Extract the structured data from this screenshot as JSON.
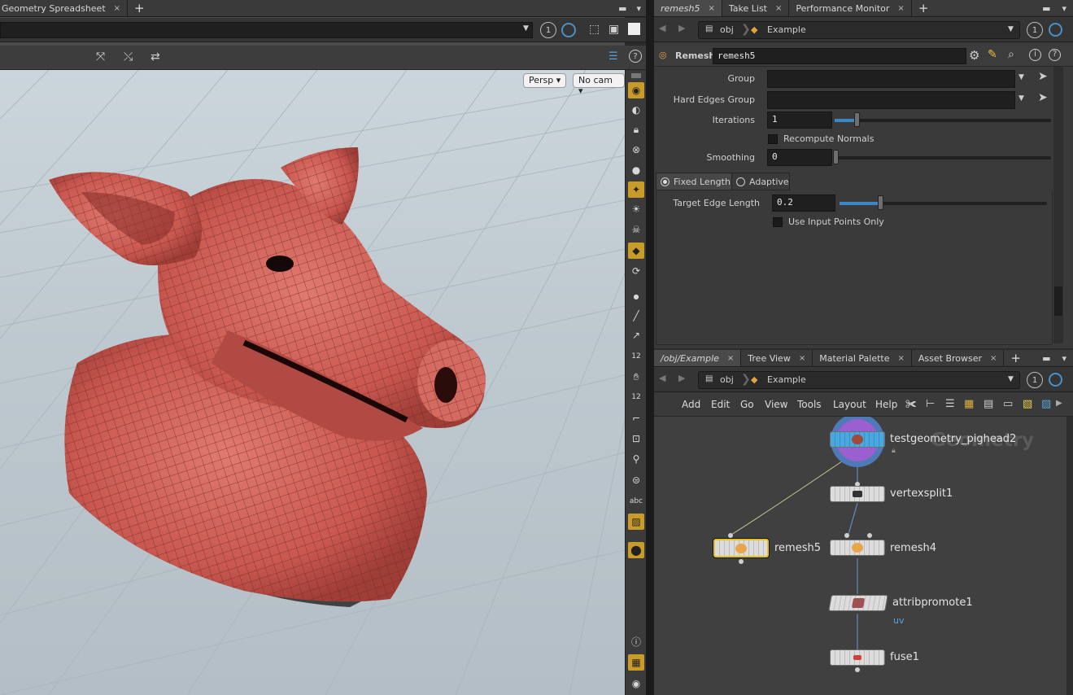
{
  "left": {
    "tab": "Geometry Spreadsheet",
    "camera": {
      "persp": "Persp",
      "cam": "No cam"
    },
    "path_num": "1"
  },
  "param_pane": {
    "tabs": [
      {
        "label": "remesh5",
        "active": true
      },
      {
        "label": "Take List"
      },
      {
        "label": "Performance Monitor"
      }
    ],
    "path": {
      "obj": "obj",
      "net": "Example",
      "num": "1"
    },
    "node_type": "Remesh",
    "node_name": "remesh5",
    "params": {
      "group_label": "Group",
      "hard_edges_label": "Hard Edges Group",
      "iterations_label": "Iterations",
      "iterations_value": "1",
      "recompute_label": "Recompute Normals",
      "smoothing_label": "Smoothing",
      "smoothing_value": "0",
      "mode_fixed": "Fixed Length",
      "mode_adaptive": "Adaptive",
      "target_label": "Target Edge Length",
      "target_value": "0.2",
      "input_points_label": "Use Input Points Only"
    }
  },
  "network_pane": {
    "tabs": [
      {
        "label": "/obj/Example",
        "active": true
      },
      {
        "label": "Tree View"
      },
      {
        "label": "Material Palette"
      },
      {
        "label": "Asset Browser"
      }
    ],
    "path": {
      "obj": "obj",
      "net": "Example",
      "num": "1"
    },
    "menu": [
      "Add",
      "Edit",
      "Go",
      "View",
      "Tools",
      "Layout",
      "Help"
    ],
    "watermark": "Geometry",
    "nodes": {
      "pighead": "testgeometry_pighead2",
      "vertexsplit": "vertexsplit1",
      "remesh5": "remesh5",
      "remesh4": "remesh4",
      "attribpromote": "attribpromote1",
      "attribpromote_sub": "uv",
      "fuse": "fuse1"
    }
  },
  "colors": {
    "accent": "#c99c2a",
    "selected_node": "#e8c21c",
    "pig": "#c9584f"
  }
}
